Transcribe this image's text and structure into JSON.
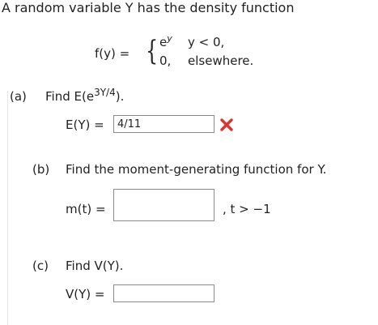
{
  "header": {
    "intro": "A random variable Y has the density function"
  },
  "density": {
    "lhs": "f(y) =",
    "case1_base": "e",
    "case1_exp": "y",
    "case1_cond": "y < 0,",
    "case2_value": "0,",
    "case2_cond": "elsewhere."
  },
  "part_a": {
    "marker": "(a)",
    "prompt_prefix": "Find E(e",
    "prompt_exp": "3Y/4",
    "prompt_suffix": ").",
    "answer_label": "E(Y) =",
    "answer_value": "4/11",
    "status": "incorrect",
    "status_icon": "red-x-icon",
    "status_color": "#e0312b"
  },
  "part_b": {
    "marker": "(b)",
    "prompt": "Find the moment-generating function for Y.",
    "answer_label": "m(t) =",
    "answer_value": "",
    "condition": ", t > −1"
  },
  "part_c": {
    "marker": "(c)",
    "prompt": "Find V(Y).",
    "answer_label": "V(Y) =",
    "answer_value": ""
  }
}
